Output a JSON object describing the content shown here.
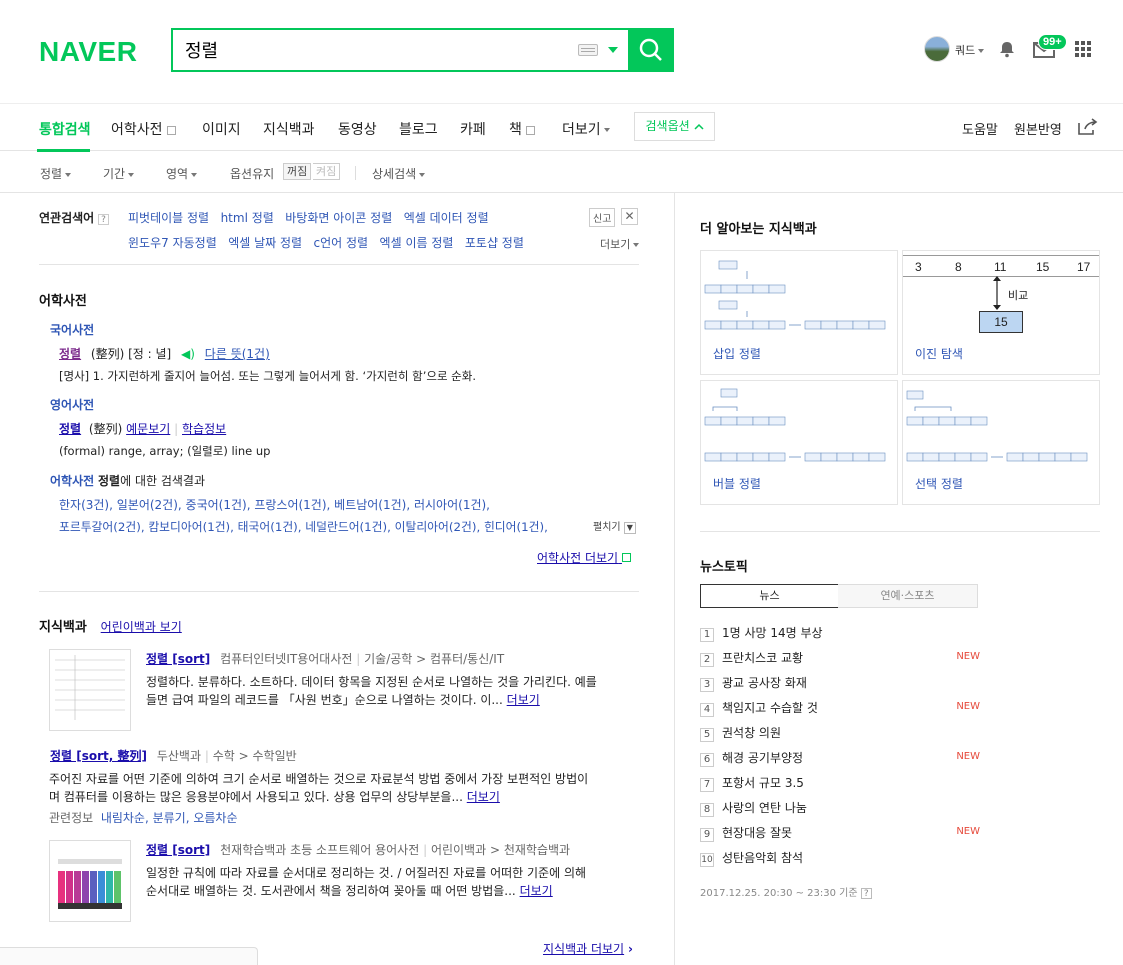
{
  "header": {
    "logo": "NAVER",
    "search_value": "정렬",
    "username": "쿼드",
    "mail_badge": "99+"
  },
  "tabs": [
    {
      "label": "통합검색"
    },
    {
      "label": "어학사전"
    },
    {
      "label": "이미지"
    },
    {
      "label": "지식백과"
    },
    {
      "label": "동영상"
    },
    {
      "label": "블로그"
    },
    {
      "label": "카페"
    },
    {
      "label": "책"
    },
    {
      "label": "더보기"
    }
  ],
  "search_options": "검색옵션",
  "right_links": {
    "help": "도움말",
    "feedback": "원본반영"
  },
  "filters": {
    "sort": "정렬",
    "period": "기간",
    "area": "영역",
    "keep_option": "옵션유지",
    "on": "꺼짐",
    "off": "켜짐",
    "detail": "상세검색"
  },
  "related": {
    "title": "연관검색어",
    "help": "?",
    "report": "신고",
    "more": "더보기",
    "row1": [
      "피벗테이블 정렬",
      "html 정렬",
      "바탕화면 아이콘 정렬",
      "엑셀 데이터 정렬"
    ],
    "row2": [
      "윈도우7 자동정렬",
      "엑셀 날짜 정렬",
      "c언어 정렬",
      "엑셀 이름 정렬",
      "포토샵 정렬"
    ]
  },
  "dictionary": {
    "title": "어학사전",
    "korean": {
      "label": "국어사전",
      "word": "정렬",
      "hanja": "(整列) [정 : 녈]",
      "other": "다른 뜻(1건)",
      "def": "[명사] 1. 가지런하게 줄지어 늘어섬. 또는 그렇게 늘어서게 함. ‘가지런히 함’으로 순화."
    },
    "english": {
      "label": "영어사전",
      "word": "정렬",
      "hanja": "(整列)",
      "example": "예문보기",
      "study": "학습정보",
      "def": "(formal) range, array; (일렬로) line up"
    },
    "result": {
      "label": "어학사전",
      "word": "정렬",
      "suffix": "에 대한 검색결과",
      "row1": "한자(3건), 일본어(2건), 중국어(1건), 프랑스어(1건), 베트남어(1건), 러시아어(1건),",
      "row2": "포르투갈어(2건), 캄보디아어(1건), 태국어(1건), 네덜란드어(1건), 이탈리아어(2건), 힌디어(1건),",
      "expand": "펼치기"
    },
    "more": "어학사전 더보기"
  },
  "encyclopedia": {
    "title": "지식백과",
    "kids": "어린이백과 보기",
    "item1": {
      "title": "정렬 [sort]",
      "source": "컴퓨터인터넷IT용어대사전",
      "cat": "기술/공학 > 컴퓨터/통신/IT",
      "line1": "정렬하다. 분류하다. 소트하다. 데이터 항목을 지정된 순서로 나열하는 것을 가리킨다. 예를",
      "line2": "들면 급여 파일의 레코드를 「사원 번호」순으로 나열하는 것이다. 이...",
      "more": "더보기"
    },
    "item2": {
      "title": "정렬 [sort, 整列]",
      "source": "두산백과",
      "cat": "수학 > 수학일반",
      "line1": "주어진 자료를 어떤 기준에 의하여 크기 순서로 배열하는 것으로 자료분석 방법 중에서 가장 보편적인 방법이",
      "line2": "며 컴퓨터를 이용하는 많은 응용분야에서 사용되고 있다. 상용 업무의 상당부분을...",
      "more": "더보기",
      "related_label": "관련정보",
      "related": "내림차순, 분류기, 오름차순"
    },
    "item3": {
      "title": "정렬 [sort]",
      "source": "천재학습백과 초등 소프트웨어 용어사전",
      "cat": "어린이백과 > 천재학습백과",
      "line1": "일정한 규칙에 따라 자료를 순서대로 정리하는 것. / 어질러진 자료를 어떠한 기준에 의해",
      "line2": "순서대로 배열하는 것. 도서관에서 책을 정리하여 꽂아둘 때 어떤 방법을...",
      "more": "더보기"
    },
    "more": "지식백과 더보기"
  },
  "sidebar": {
    "knowledge_title": "더 알아보는 지식백과",
    "cards": [
      {
        "label": "삽입 정렬"
      },
      {
        "label": "이진 탐색"
      },
      {
        "label": "버블 정렬"
      },
      {
        "label": "선택 정렬"
      }
    ],
    "binary": {
      "cells": [
        "3",
        "8",
        "11",
        "15",
        "17"
      ],
      "compare": "비교",
      "target": "15"
    },
    "news_title": "뉴스토픽",
    "news_tabs": [
      "뉴스",
      "연예·스포츠"
    ],
    "news": [
      {
        "n": "1",
        "t": "1명 사망 14명 부상",
        "new": ""
      },
      {
        "n": "2",
        "t": "프란치스코 교황",
        "new": "NEW"
      },
      {
        "n": "3",
        "t": "광교 공사장 화재",
        "new": ""
      },
      {
        "n": "4",
        "t": "책임지고 수습할 것",
        "new": "NEW"
      },
      {
        "n": "5",
        "t": "권석창 의원",
        "new": ""
      },
      {
        "n": "6",
        "t": "해경 공기부양정",
        "new": "NEW"
      },
      {
        "n": "7",
        "t": "포항서 규모 3.5",
        "new": ""
      },
      {
        "n": "8",
        "t": "사랑의 연탄 나눔",
        "new": ""
      },
      {
        "n": "9",
        "t": "현장대응 잘못",
        "new": "NEW"
      },
      {
        "n": "10",
        "t": "성탄음악회 참석",
        "new": ""
      }
    ],
    "news_time": "2017.12.25. 20:30 ~ 23:30 기준",
    "news_help": "?"
  },
  "colors": {
    "brand": "#03c75a",
    "link": "#2f56b5",
    "new": "#e64a3b"
  }
}
